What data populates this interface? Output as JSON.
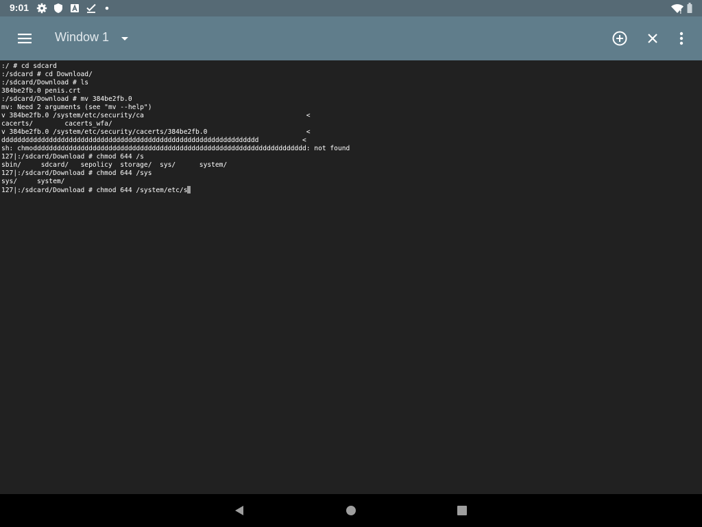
{
  "status_bar": {
    "time": "9:01",
    "icons": [
      "gear-icon",
      "shield-icon",
      "a-box-icon",
      "check-icon",
      "dot-icon"
    ],
    "right_icons": [
      "wifi-icon",
      "battery-icon"
    ]
  },
  "app_bar": {
    "title": "Window 1",
    "actions": [
      "menu-icon",
      "dropdown-icon",
      "add-window-icon",
      "close-window-icon",
      "more-options-icon"
    ]
  },
  "terminal": {
    "lines": [
      ":/ # cd sdcard",
      ":/sdcard # cd Download/",
      ":/sdcard/Download # ls",
      "384be2fb.0 penis.crt",
      ":/sdcard/Download # mv 384be2fb.0",
      "mv: Need 2 arguments (see \"mv --help\")",
      "v 384be2fb.0 /system/etc/security/ca                                         <",
      "cacerts/        cacerts_wfa/",
      "v 384be2fb.0 /system/etc/security/cacerts/384be2fb.0                         <",
      "ddddddddddddddddddddddddddddddddddddddddddddddddddddddddddddddddd           <",
      "sh: chmoddddddddddddddddddddddddddddddddddddddddddddddddddddddddddddddddddddd: not found",
      "127|:/sdcard/Download # chmod 644 /s",
      "sbin/     sdcard/   sepolicy  storage/  sys/      system/",
      "127|:/sdcard/Download # chmod 644 /sys",
      "sys/     system/",
      "127|:/sdcard/Download # chmod 644 /system/etc/s"
    ]
  },
  "nav_bar": {
    "buttons": [
      "back-icon",
      "home-icon",
      "recents-icon"
    ]
  },
  "colors": {
    "status_bar": "#566a75",
    "app_bar": "#607d8b",
    "terminal_bg": "#212121",
    "terminal_text": "#ffffff",
    "nav_bar": "#000000"
  }
}
